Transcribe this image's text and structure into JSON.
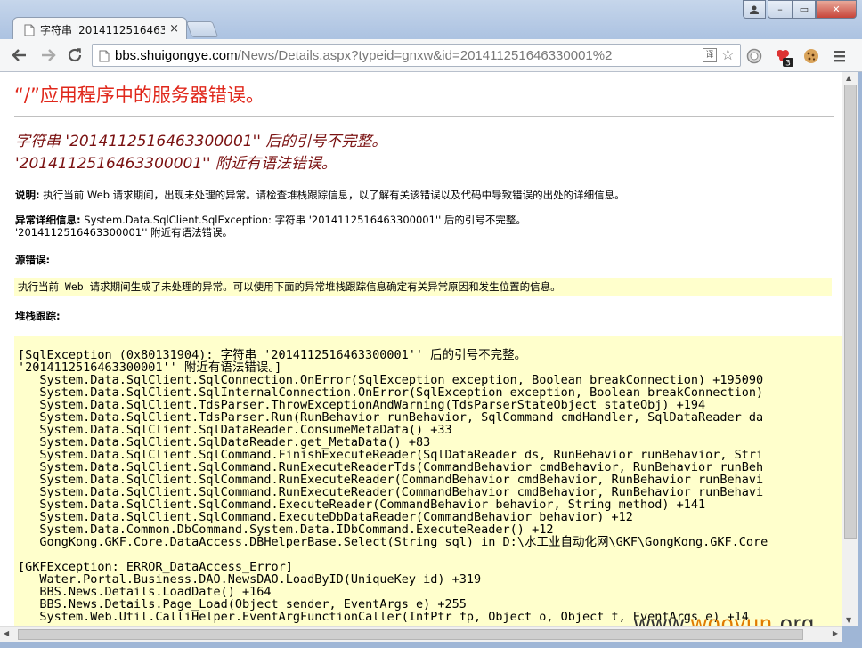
{
  "browser": {
    "tab_title": "字符串 '2014112516463300",
    "tab_close": "×",
    "url_host": "bbs.shuigongye.com",
    "url_path": "/News/Details.aspx?typeid=gnxw&id=201411251646330001%2",
    "extension_badge": "3",
    "window_controls": {
      "minimize": "–",
      "maximize": "▭",
      "close": "✕"
    }
  },
  "page": {
    "heading": "“/”应用程序中的服务器错误。",
    "error_title_line1": "字符串 '2014112516463300001'' 后的引号不完整。",
    "error_title_line2": "'2014112516463300001'' 附近有语法错误。",
    "description_label": "说明:",
    "description_text": " 执行当前 Web 请求期间，出现未处理的异常。请检查堆栈跟踪信息，以了解有关该错误以及代码中导致错误的出处的详细信息。",
    "exception_label": "异常详细信息:",
    "exception_text_line1": " System.Data.SqlClient.SqlException: 字符串 '2014112516463300001'' 后的引号不完整。",
    "exception_text_line2": "'2014112516463300001'' 附近有语法错误。",
    "source_error_label": "源错误:",
    "source_error_text": "执行当前 Web 请求期间生成了未处理的异常。可以使用下面的异常堆栈跟踪信息确定有关异常原因和发生位置的信息。",
    "stack_trace_label": "堆栈跟踪:",
    "stack_trace": "[SqlException (0x80131904): 字符串 '2014112516463300001'' 后的引号不完整。\n'2014112516463300001'' 附近有语法错误。]\n   System.Data.SqlClient.SqlConnection.OnError(SqlException exception, Boolean breakConnection) +195090\n   System.Data.SqlClient.SqlInternalConnection.OnError(SqlException exception, Boolean breakConnection)\n   System.Data.SqlClient.TdsParser.ThrowExceptionAndWarning(TdsParserStateObject stateObj) +194\n   System.Data.SqlClient.TdsParser.Run(RunBehavior runBehavior, SqlCommand cmdHandler, SqlDataReader da\n   System.Data.SqlClient.SqlDataReader.ConsumeMetaData() +33\n   System.Data.SqlClient.SqlDataReader.get_MetaData() +83\n   System.Data.SqlClient.SqlCommand.FinishExecuteReader(SqlDataReader ds, RunBehavior runBehavior, Stri\n   System.Data.SqlClient.SqlCommand.RunExecuteReaderTds(CommandBehavior cmdBehavior, RunBehavior runBeh\n   System.Data.SqlClient.SqlCommand.RunExecuteReader(CommandBehavior cmdBehavior, RunBehavior runBehavi\n   System.Data.SqlClient.SqlCommand.RunExecuteReader(CommandBehavior cmdBehavior, RunBehavior runBehavi\n   System.Data.SqlClient.SqlCommand.ExecuteReader(CommandBehavior behavior, String method) +141\n   System.Data.SqlClient.SqlCommand.ExecuteDbDataReader(CommandBehavior behavior) +12\n   System.Data.Common.DbCommand.System.Data.IDbCommand.ExecuteReader() +12\n   GongKong.GKF.Core.DataAccess.DBHelperBase.Select(String sql) in D:\\水工业自动化网\\GKF\\GongKong.GKF.Core\n\n[GKFException: ERROR_DataAccess_Error]\n   Water.Portal.Business.DAO.NewsDAO.LoadByID(UniqueKey id) +319\n   BBS.News.Details.LoadDate() +164\n   BBS.News.Details.Page_Load(Object sender, EventArgs e) +255\n   System.Web.Util.CalliHelper.EventArgFunctionCaller(IntPtr fp, Object o, Object t, EventArgs e) +14"
  },
  "watermark": {
    "prefix": "www.",
    "brand": "wooyun",
    "suffix": ".org"
  },
  "colors": {
    "heading": "#e0281c",
    "error_title": "#7a1111",
    "yellow_box": "#ffffcc"
  }
}
